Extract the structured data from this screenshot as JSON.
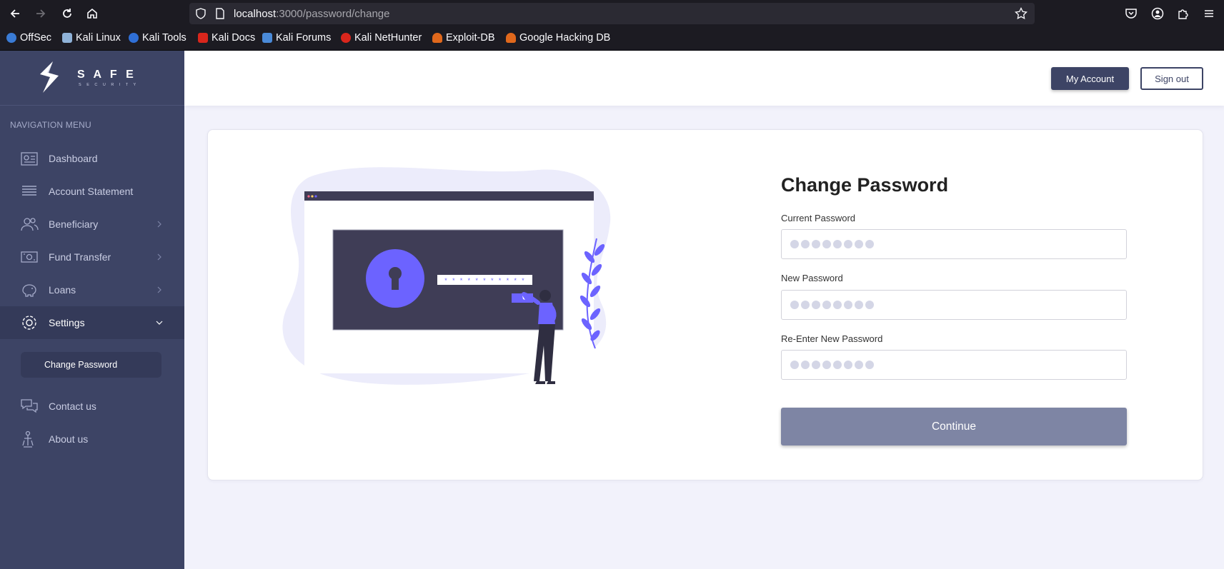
{
  "browser": {
    "url_host": "localhost",
    "url_path": ":3000/password/change",
    "bookmarks": [
      {
        "label": "OffSec",
        "color": "#3a7bd5"
      },
      {
        "label": "Kali Linux",
        "color": "#8fb2d8"
      },
      {
        "label": "Kali Tools",
        "color": "#2f6fd6"
      },
      {
        "label": "Kali Docs",
        "color": "#d9261c"
      },
      {
        "label": "Kali Forums",
        "color": "#4a8ad8"
      },
      {
        "label": "Kali NetHunter",
        "color": "#d9261c"
      },
      {
        "label": "Exploit-DB",
        "color": "#e0681c"
      },
      {
        "label": "Google Hacking DB",
        "color": "#e0681c"
      }
    ]
  },
  "sidebar": {
    "logo_word": "S A F E",
    "logo_sub": "S E C U R I T Y",
    "nav_title": "NAVIGATION MENU",
    "items": [
      {
        "label": "Dashboard",
        "icon": "dashboard-icon"
      },
      {
        "label": "Account Statement",
        "icon": "statement-icon"
      },
      {
        "label": "Beneficiary",
        "icon": "beneficiary-icon"
      },
      {
        "label": "Fund Transfer",
        "icon": "fund-transfer-icon"
      },
      {
        "label": "Loans",
        "icon": "loans-icon"
      },
      {
        "label": "Settings",
        "icon": "settings-icon"
      },
      {
        "label": "Contact us",
        "icon": "contact-icon"
      },
      {
        "label": "About us",
        "icon": "about-icon"
      }
    ],
    "sub_item": "Change Password"
  },
  "header": {
    "account_label": "My Account",
    "signout_label": "Sign out"
  },
  "form": {
    "title": "Change Password",
    "current_label": "Current Password",
    "new_label": "New Password",
    "reenter_label": "Re-Enter New Password",
    "submit_label": "Continue"
  },
  "illustration": {
    "password_mask": "* * * * * * * * * * *"
  },
  "colors": {
    "sidebar": "#3d4465",
    "accent": "#6c63ff",
    "button_disabled": "#7e85a4"
  }
}
